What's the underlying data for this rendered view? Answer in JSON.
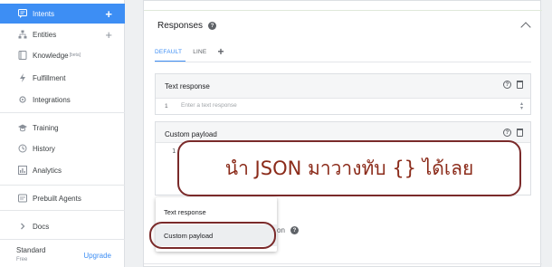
{
  "sidebar": {
    "items": [
      {
        "label": "Intents",
        "icon": "intents-icon",
        "active": true,
        "plus": "+"
      },
      {
        "label": "Entities",
        "icon": "entities-icon",
        "plus": "+"
      },
      {
        "label": "Knowledge",
        "icon": "knowledge-icon",
        "badge": "[beta]"
      },
      {
        "label": "Fulfillment",
        "icon": "fulfillment-icon"
      },
      {
        "label": "Integrations",
        "icon": "integrations-icon"
      },
      {
        "label": "Training",
        "icon": "training-icon"
      },
      {
        "label": "History",
        "icon": "history-icon"
      },
      {
        "label": "Analytics",
        "icon": "analytics-icon"
      },
      {
        "label": "Prebuilt Agents",
        "icon": "prebuilt-agents-icon"
      },
      {
        "label": "Docs",
        "icon": "chevron-right-icon"
      }
    ],
    "plan": "Standard",
    "plan_sub": "Free",
    "upgrade": "Upgrade"
  },
  "responses": {
    "title": "Responses",
    "tabs": [
      "DEFAULT",
      "LINE"
    ],
    "add_tab": "+",
    "text_response": {
      "title": "Text response",
      "row_number": "1",
      "placeholder": "Enter a text response"
    },
    "custom_payload": {
      "title": "Custom payload",
      "line_number": "1",
      "code": "{}"
    }
  },
  "dropdown": {
    "items": [
      "Text response",
      "Custom payload"
    ],
    "highlighted": 1
  },
  "hidden_text_fragment": "on",
  "callout": {
    "text": "นำ JSON มาวางทับ {} ได้เลย"
  },
  "colors": {
    "accent": "#3d8ef4",
    "annotation": "#7a2a2a"
  }
}
